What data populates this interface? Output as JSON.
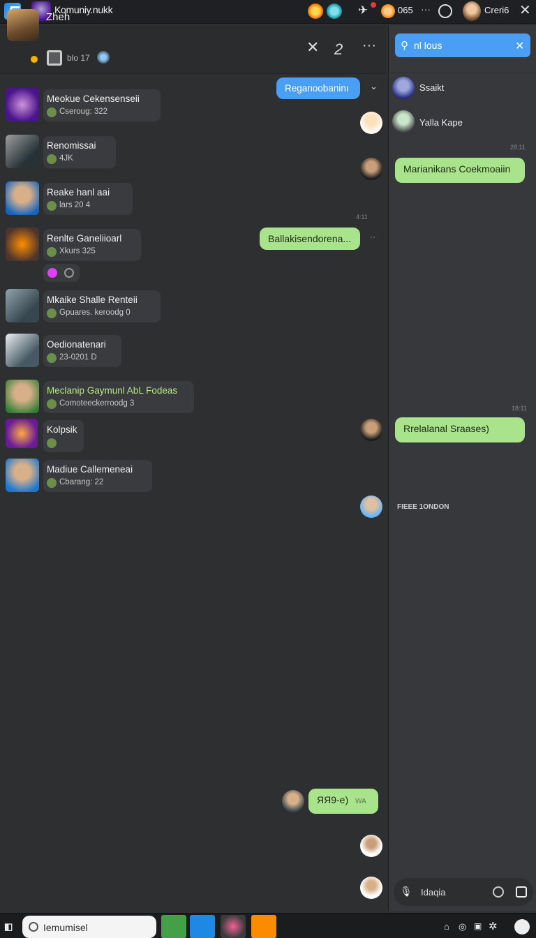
{
  "topbar": {
    "app_title": "Komuniy.nukk",
    "badge_count": "065",
    "more": "···",
    "user_name": "Creri6"
  },
  "chat_header": {
    "name": "Zheh",
    "subtitle": "blo 17"
  },
  "contacts": [
    {
      "name": "Meokue Cekensenseii",
      "sub": "Cseroug: 322"
    },
    {
      "name": "Renomissai",
      "sub": "4JK"
    },
    {
      "name": "Reake hanl aai",
      "sub": "lars 20 4"
    },
    {
      "name": "Renlte Ganeliioarl",
      "sub": "Xkurs 325"
    },
    {
      "name": "Mkaike Shalle Renteii",
      "sub": "Gpuares. keroodg 0"
    },
    {
      "name": "Oedionatenari",
      "sub": "23-0201 D"
    },
    {
      "name": "Meclanip Gaymunl AbL Fodeas",
      "sub": "Comoteeckerroodg 3"
    },
    {
      "name": "Kolpsik",
      "sub": ""
    },
    {
      "name": "Madiue Callemeneai",
      "sub": "Cbarang: 22"
    }
  ],
  "left_chat": {
    "bubble_1": "Reganoobaninı",
    "bubble_2": "Ballakisendorena...",
    "bubble_3": "ЯЯ9-е)",
    "bubble_3_tail": "WA",
    "time_1": "4:11"
  },
  "right_pane": {
    "search_value": "nl lous",
    "user_1": "Ssaikt",
    "user_2": "Yalla Kape",
    "time_1": "28:11",
    "bubble_1": "Marianikans Coekmoaiin",
    "time_2": "18:11",
    "bubble_2": "Rrelalanal Sraases)",
    "label_1": "FIEEE 1ONDON",
    "compose_placeholder": "Idaqia"
  },
  "taskbar": {
    "search_value": "Iemumisel"
  },
  "colors": {
    "accent_blue": "#4a9ff5",
    "bubble_green": "#a9e38b",
    "background": "#2e2f31"
  }
}
